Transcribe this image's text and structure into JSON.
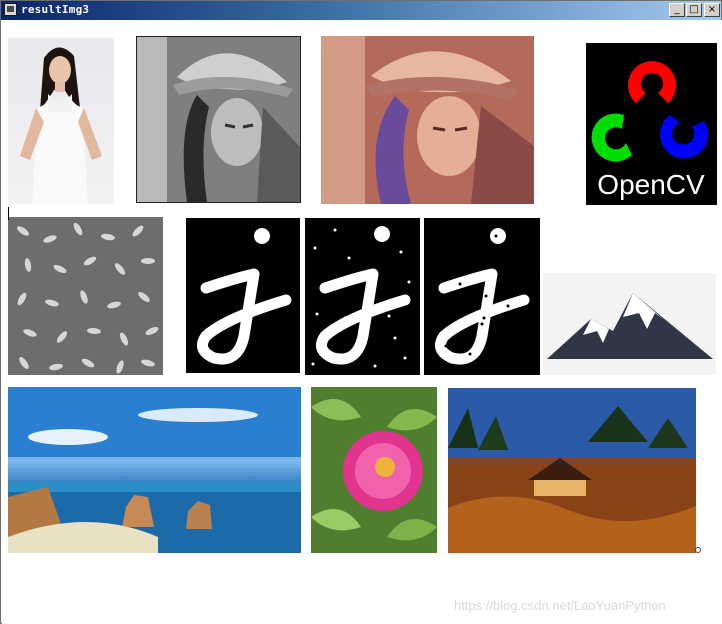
{
  "window": {
    "title": "resultImg3",
    "buttons": {
      "minimize": "_",
      "maximize": "□",
      "close": "×"
    }
  },
  "images": {
    "opencv_logo_text": "OpenCV"
  },
  "watermark": "https://blog.csdn.net/LaoYuanPython",
  "colors": {
    "titlebar_start": "#0a246a",
    "titlebar_end": "#a6caf0",
    "opencv_red": "#ff0000",
    "opencv_green": "#00dd00",
    "opencv_blue": "#0000ff"
  }
}
